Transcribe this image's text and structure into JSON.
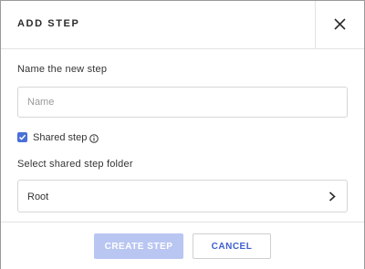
{
  "dialog": {
    "title": "ADD STEP"
  },
  "form": {
    "name_label": "Name the new step",
    "name_placeholder": "Name",
    "name_value": "",
    "shared_checkbox_label": "Shared step",
    "shared_checked": true,
    "folder_label": "Select shared step folder",
    "folder_value": "Root"
  },
  "footer": {
    "create_label": "CREATE STEP",
    "cancel_label": "CANCEL"
  },
  "colors": {
    "accent": "#4a6fd8",
    "create_disabled_bg": "#b9c6f2",
    "cancel_text": "#3d5fd0"
  },
  "icons": {
    "close": "close-icon",
    "check": "checkmark-icon",
    "info": "info-icon",
    "chevron": "chevron-right-icon"
  }
}
